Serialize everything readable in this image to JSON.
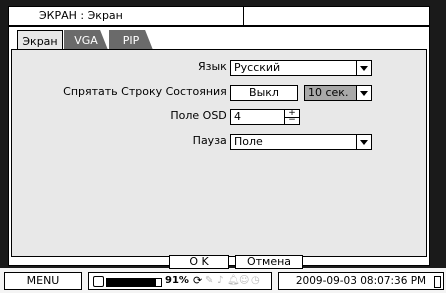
{
  "title": "ЭКРАН : Экран",
  "tabs": [
    {
      "label": "Экран",
      "active": true
    },
    {
      "label": "VGA",
      "active": false
    },
    {
      "label": "PIP",
      "active": false
    }
  ],
  "settings": {
    "language": {
      "label": "Язык :",
      "value": "Русский"
    },
    "hide_status": {
      "label": "Спрятать Строку Состояния :",
      "state": "Выкл",
      "timeout": "10 сек."
    },
    "osd_field": {
      "label": "Поле OSD :",
      "value": "4"
    },
    "pause": {
      "label": "Пауза :",
      "value": "Поле"
    }
  },
  "buttons": {
    "ok": "O K",
    "cancel": "Отмена"
  },
  "statusbar": {
    "menu": "MENU",
    "disk_percent": "91%",
    "disk_fill": 0.91,
    "datetime": "2009-09-03 08:07:36 PM"
  }
}
